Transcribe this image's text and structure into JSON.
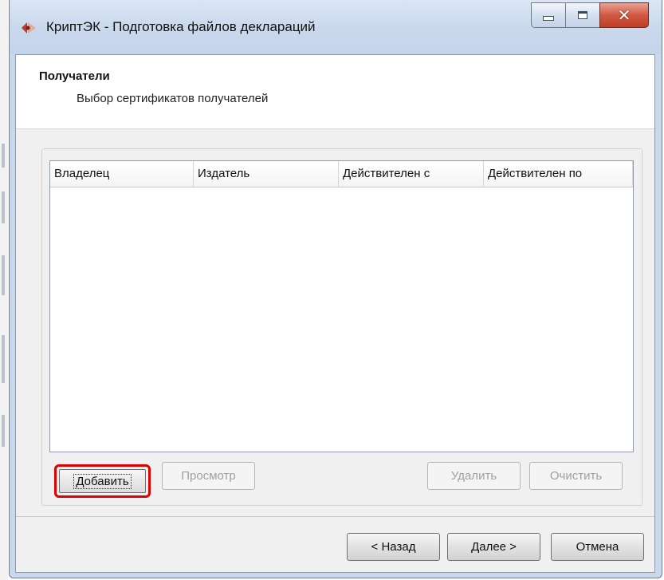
{
  "window": {
    "title": "КриптЭК - Подготовка файлов деклараций",
    "close_glyph": "✕"
  },
  "header": {
    "title": "Получатели",
    "subtitle": "Выбор сертификатов получателей"
  },
  "table": {
    "columns": [
      "Владелец",
      "Издатель",
      "Действителен с",
      "Действителен по"
    ],
    "rows": []
  },
  "actions": {
    "add": "Добавить",
    "view": "Просмотр",
    "delete": "Удалить",
    "clear": "Очистить"
  },
  "nav": {
    "back": "< Назад",
    "next": "Далее >",
    "cancel": "Отмена"
  },
  "colors": {
    "highlight": "#e00000"
  }
}
